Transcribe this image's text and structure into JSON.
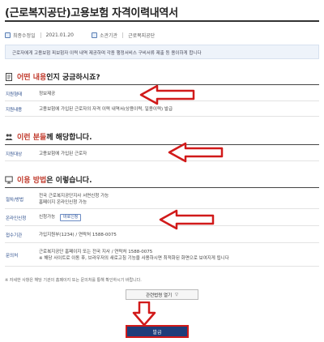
{
  "page": {
    "title": "(근로복지공단)고용보험 자격이력내역서"
  },
  "meta": {
    "updated_label": "최종수정일",
    "updated_value": "2021.01.20",
    "agency_label": "소관기관",
    "agency_value": "근로복지공단"
  },
  "description": "근로자에게 고용보험 피보험자 이력 내역 제공하며 각종 행정서비스 구비서류 제출 등 용이하게 합니다",
  "sections": {
    "what": {
      "prefix": "어떤 내용",
      "suffix": "인지 궁금하시죠?",
      "rows": [
        {
          "label": "지원형태",
          "value": "정보제공"
        },
        {
          "label": "지원내용",
          "value": "고용보험에 가입된 근로자의 자격 이력 내역서(상용이력, 일용이력) 발급"
        }
      ]
    },
    "who": {
      "prefix": "이런 분들",
      "suffix": "께 해당합니다.",
      "rows": [
        {
          "label": "지원대상",
          "value": "고용보험에 가입된 근로자"
        }
      ]
    },
    "how": {
      "prefix": "이용 방법",
      "suffix": "은 이렇습니다.",
      "rows": [
        {
          "label": "절차/방법",
          "value_line1": "전국 근로복지공단지사 서면신청 가능",
          "value_line2": "홈페이지 온라인신청 가능"
        },
        {
          "label": "온라인신청",
          "value": "신청가능",
          "badge": "바로신청"
        },
        {
          "label": "접수기관",
          "value": "가입지원부(1234) / 연락처 1588-0075"
        },
        {
          "label": "문의처",
          "value_line1": "근로복지공단 홈페이지 또는 전국 지사 / 연락처 1588-0075",
          "value_line2": "※ 해당 사이트로 이동 후, 브라우저의 새로고침 기능을 사용하시면 최적화된 화면으로 보여지게 됩니다"
        }
      ]
    }
  },
  "footnote": "※ 자세한 사항은 해당 기관의 홈페이지 또는 문의처를 통해 확인하시기 바랍니다.",
  "more_button": "관련법령 열기",
  "issue_button": "발급"
}
